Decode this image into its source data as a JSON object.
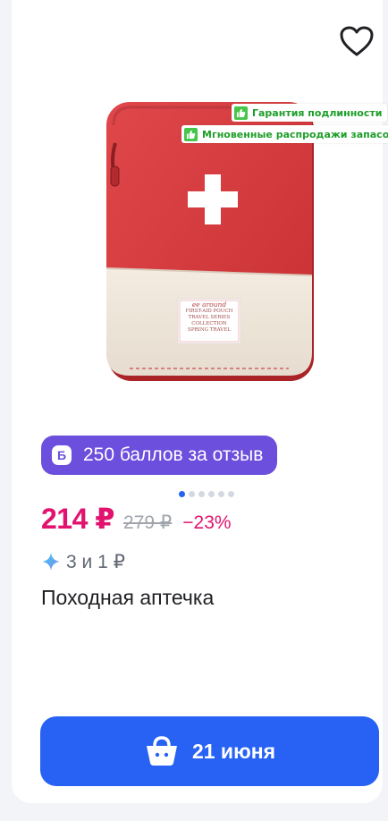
{
  "product": {
    "title": "Походная аптечка",
    "badges": [
      "Гарантия подлинности",
      "Мгновенные распродажи запасов"
    ],
    "tag_text": {
      "brand": "ee around",
      "line1": "FIRST-AID POUCH",
      "line2": "TRAVEL SERIES COLLECTION",
      "line3": "SPRING TRAVEL"
    },
    "carousel": {
      "total": 6,
      "active": 1
    }
  },
  "bonus": {
    "icon_letter": "Б",
    "text": "250 баллов за отзыв"
  },
  "price": {
    "current": "214 ₽",
    "old": "279 ₽",
    "discount": "−23%"
  },
  "split": {
    "text": "3 и 1 ₽"
  },
  "cart": {
    "label": "21 июня"
  },
  "colors": {
    "price": "#e2136e",
    "button": "#2762f4",
    "bonus_bg": "#6c4fdc",
    "badge_green": "#1d9e28"
  },
  "icons": {
    "favorite": "heart-icon",
    "cart": "basket-icon",
    "split": "sparkle-icon",
    "badge": "thumbs-up-icon"
  }
}
